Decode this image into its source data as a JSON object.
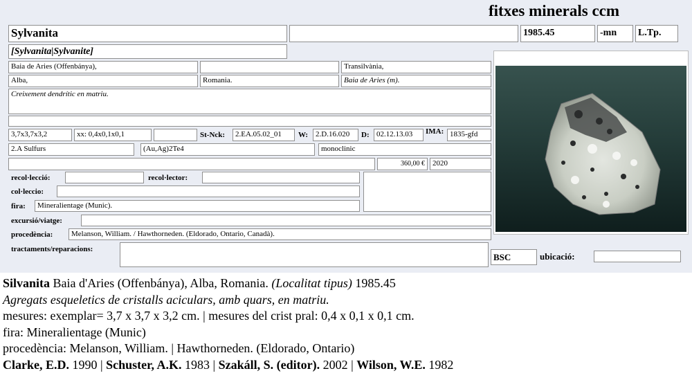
{
  "header": {
    "app_title": "fitxes minerals ccm"
  },
  "record": {
    "name": "Sylvanita",
    "synonyms": "[Sylvanita|Sylvanite]",
    "number": "1985.45",
    "suffix": "-mn",
    "type_tag": "L.Tp.",
    "locality": "Baia de Aries (Offenbánya),",
    "region": "Transilvània,",
    "county": "Alba,",
    "country": "Romania.",
    "locality_short": "Baia de Aries (m).",
    "description": "Creixement dendrític en matriu.",
    "dimensions": "3,7x3,7x3,2",
    "crystal_size": "xx: 0,4x0,1x0,1",
    "st_nck_label": "St-Nck:",
    "st_nck": "2.EA.05.02_01",
    "w_label": "W:",
    "w_value": "2.D.16.020",
    "d_label": "D:",
    "d_value": "02.12.13.03",
    "ima_label": "IMA:",
    "ima_value": "1835-gfd",
    "class": "2.A Sulfurs",
    "formula": "(Au,Ag)2Te4",
    "crystal_system": "monoclinic",
    "price": "360,00 €",
    "year": "2020",
    "collection_label": "recol·lecció:",
    "collector_label": "recol·lector:",
    "collection2_label": "col·leccio:",
    "fair_label": "fira:",
    "fair": "Mineralientage (Munic).",
    "excursion_label": "excursió/viatge:",
    "provenance_label": "procedència:",
    "provenance": "Melanson, William. / Hawthorneden. (Eldorado, Ontario, Canadà).",
    "treatments_label": "tractaments/reparacions:",
    "location_code": "BSC",
    "location_label": "ubicació:"
  },
  "footer": {
    "line1_name": "Silvanita",
    "line1_locality": " Baia d'Aries (Offenbánya), Alba, Romania. ",
    "line1_type": "(Localitat tipus)",
    "line1_number": " 1985.45",
    "line2": "Agregats esqueletics de cristalls aciculars, amb quars, en matriu.",
    "line3": "mesures: exemplar= 3,7 x 3,7 x 3,2 cm. | mesures del crist pral: 0,4 x 0,1 x 0,1 cm.",
    "line4": "fira: Mineralientage (Munic)",
    "line5": "procedència: Melanson, William. | Hawthorneden. (Eldorado, Ontario)",
    "refs": [
      {
        "author": "Clarke, E.D.",
        "year": " 1990 | "
      },
      {
        "author": "Schuster, A.K.",
        "year": " 1983 | "
      },
      {
        "author": "Szakáll, S. (editor).",
        "year": " 2002 | "
      },
      {
        "author": "Wilson, W.E.",
        "year": " 1982"
      }
    ]
  },
  "colors": {
    "card_bg": "#eaedf4",
    "photo_bg": "#243c39"
  },
  "photo": {
    "icon": "mineral-specimen-photo"
  }
}
